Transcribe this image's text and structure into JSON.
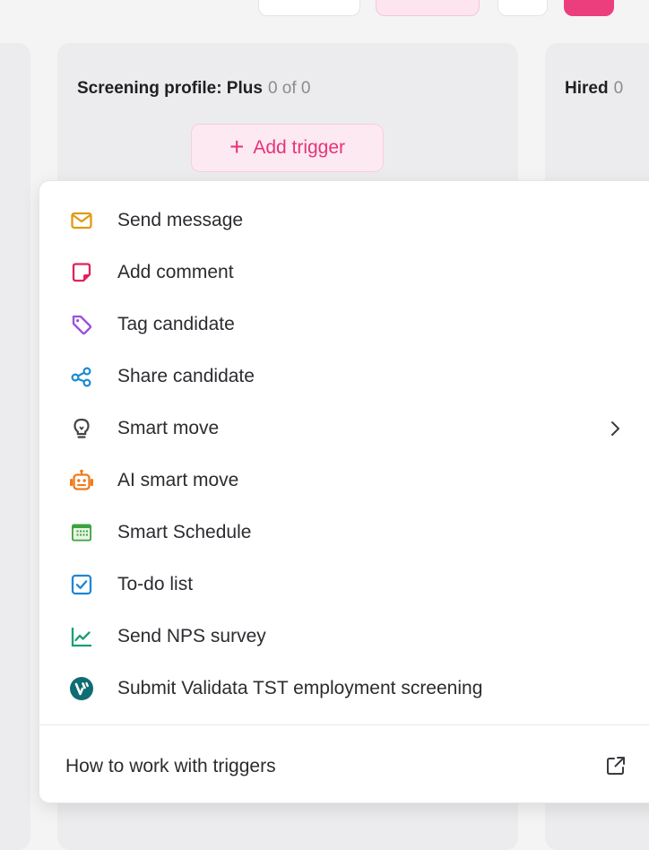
{
  "colors": {
    "accent": "#e5347a",
    "message_icon": "#e09a12",
    "comment_icon": "#e0245a",
    "tag_icon": "#9a4fe0",
    "share_icon": "#1a8ad1",
    "ai_icon": "#f07a1c",
    "schedule_icon": "#3da340",
    "todo_icon": "#1f86d6",
    "nps_icon": "#1b9e77",
    "validata_icon": "#0e6c73"
  },
  "columns": {
    "main": {
      "title": "Screening profile: Plus",
      "count": "0 of 0"
    },
    "right": {
      "title": "Hired",
      "count": "0"
    }
  },
  "add_trigger": {
    "label": "Add trigger"
  },
  "menu": {
    "items": [
      {
        "label": "Send message",
        "icon": "envelope-icon"
      },
      {
        "label": "Add comment",
        "icon": "note-icon"
      },
      {
        "label": "Tag candidate",
        "icon": "tag-icon"
      },
      {
        "label": "Share candidate",
        "icon": "share-icon"
      },
      {
        "label": "Smart move",
        "icon": "lightbulb-icon"
      },
      {
        "label": "AI smart move",
        "icon": "robot-icon"
      },
      {
        "label": "Smart Schedule",
        "icon": "calendar-icon"
      },
      {
        "label": "To-do list",
        "icon": "checkbox-icon"
      },
      {
        "label": "Send NPS survey",
        "icon": "chart-line-icon"
      },
      {
        "label": "Submit Validata TST employment screening",
        "icon": "validata-logo-icon"
      }
    ],
    "footer": {
      "label": "How to work with triggers",
      "icon": "external-link-icon"
    }
  }
}
